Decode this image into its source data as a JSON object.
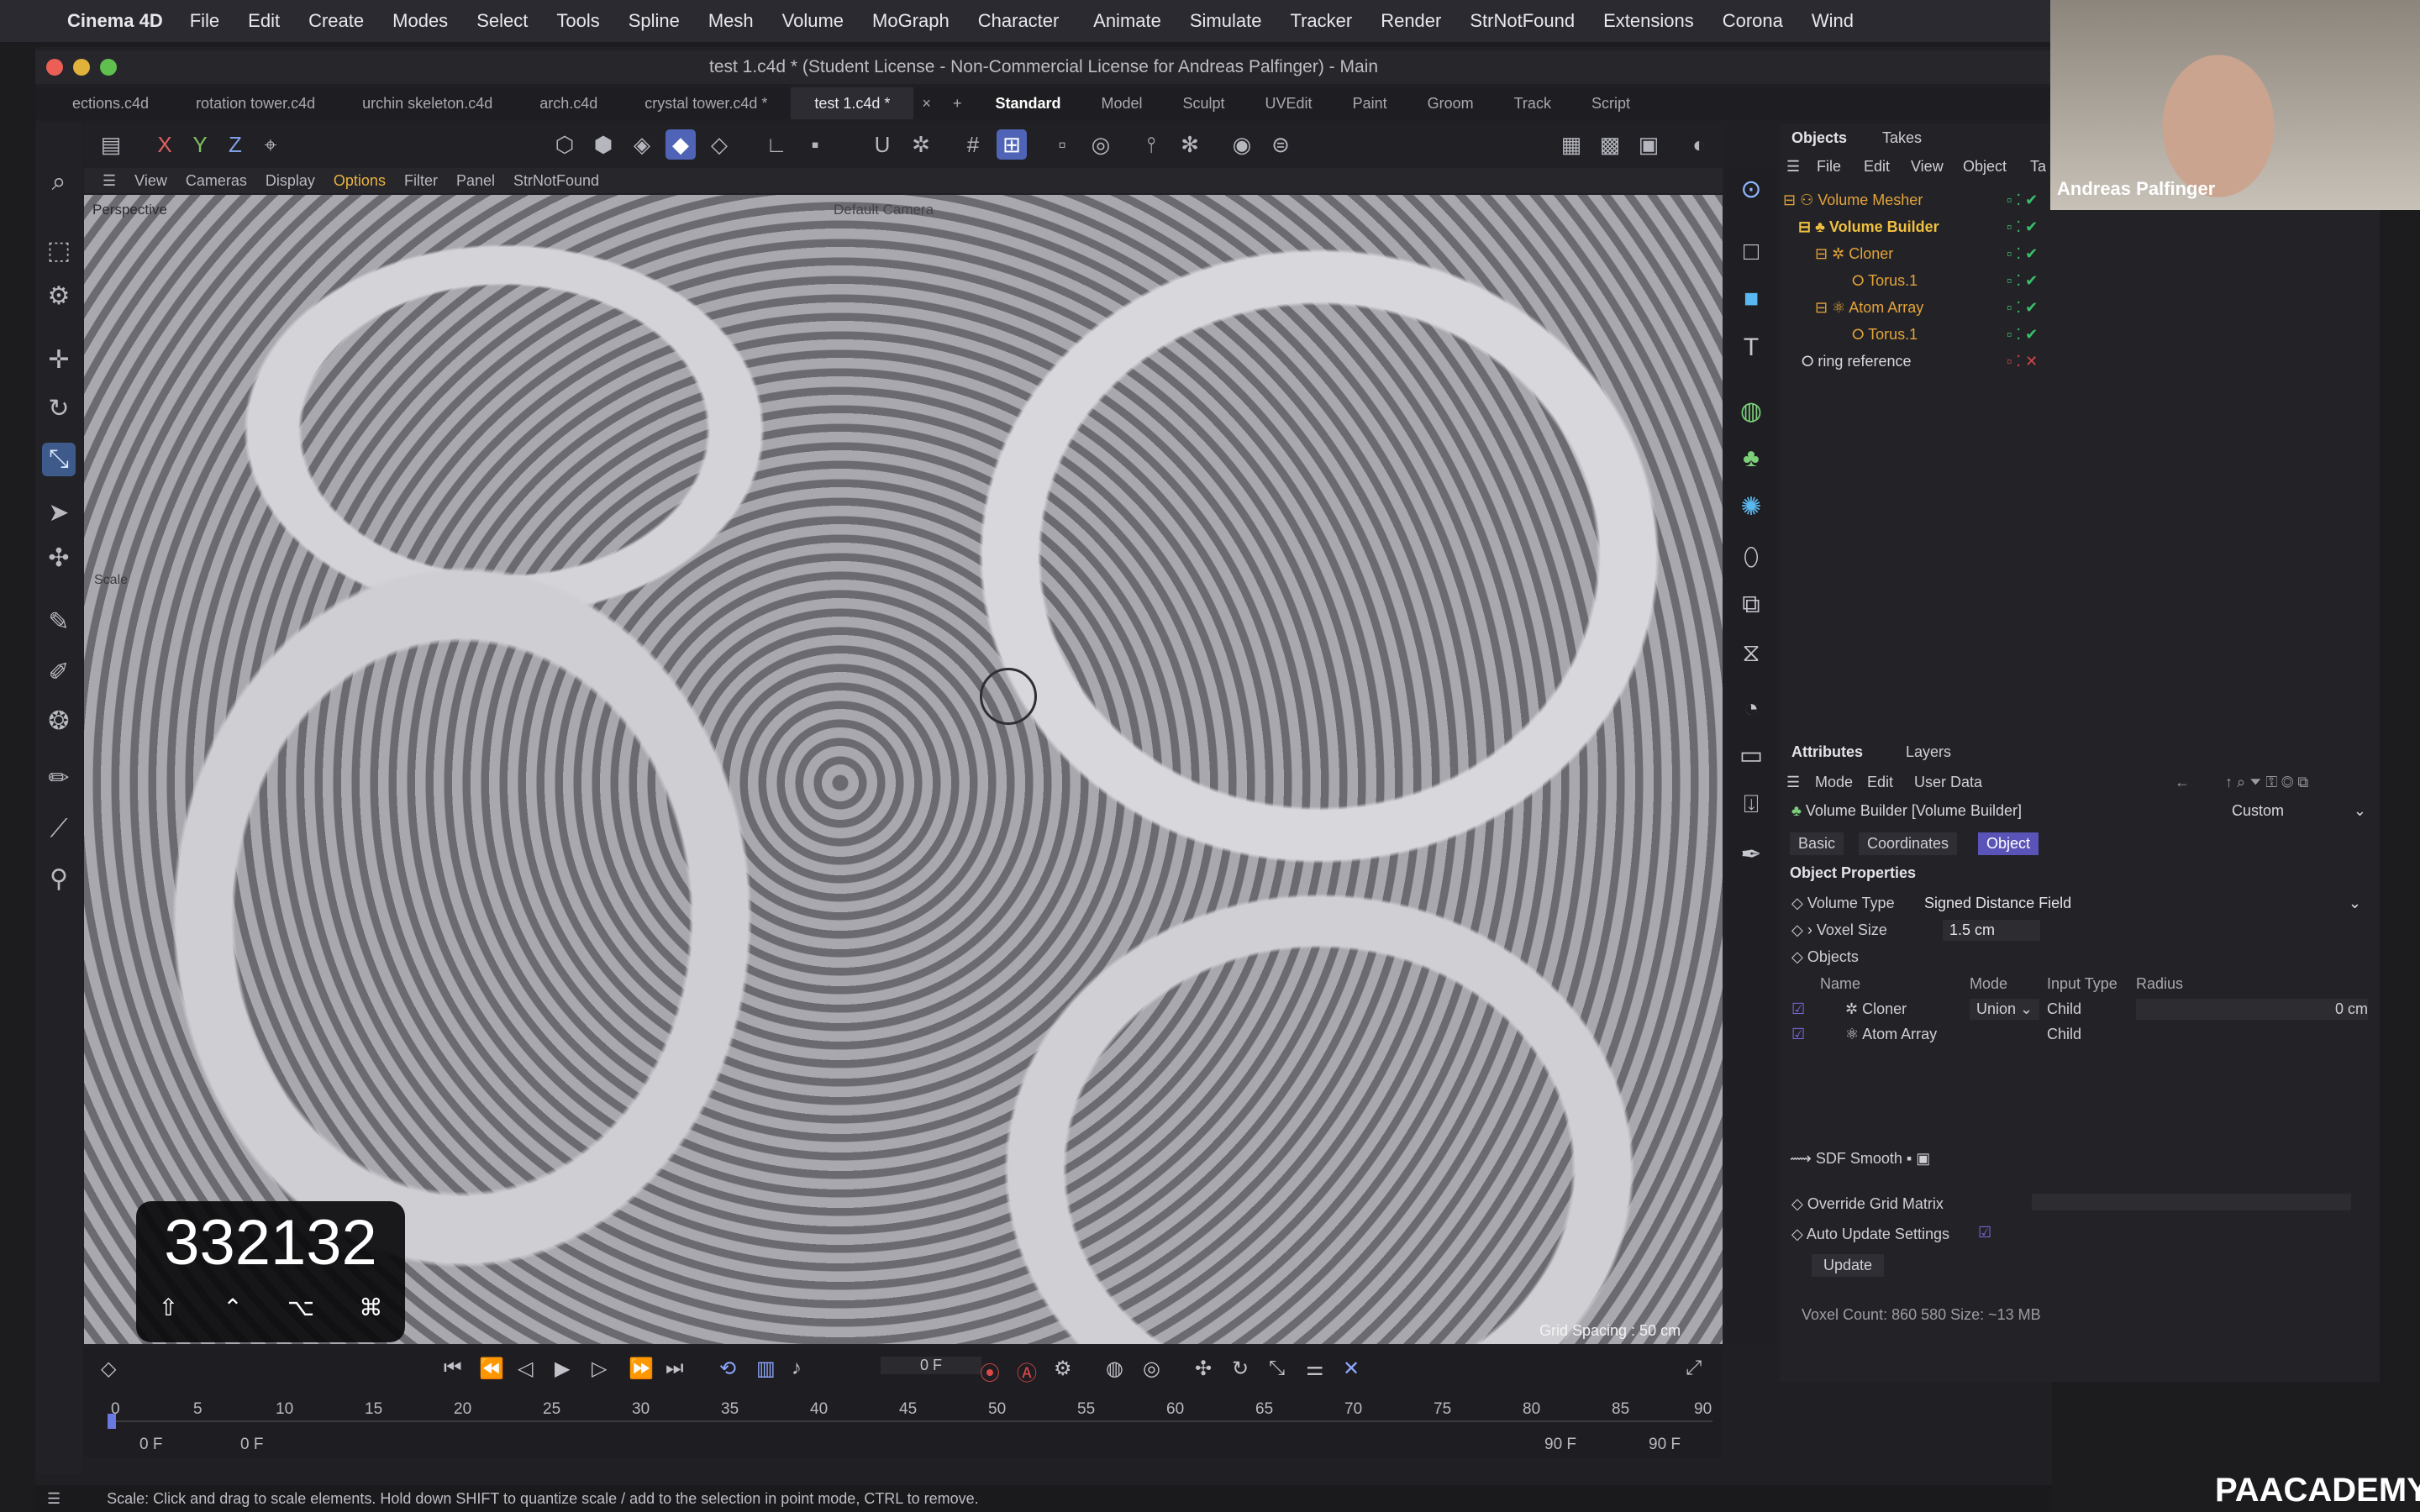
{
  "menubar": {
    "app": "Cinema 4D",
    "items": [
      "File",
      "Edit",
      "Create",
      "Modes",
      "Select",
      "Tools",
      "Spline",
      "Mesh",
      "Volume",
      "MoGraph",
      "Character"
    ],
    "right_items": [
      "Animate",
      "Simulate",
      "Tracker",
      "Render",
      "StrNotFound",
      "Extensions",
      "Corona",
      "Wind"
    ]
  },
  "window": {
    "title": "test 1.c4d * (Student License - Non-Commercial License for Andreas Palfinger) - Main"
  },
  "tabs": {
    "files": [
      "ections.c4d",
      "rotation tower.c4d",
      "urchin skeleton.c4d",
      "arch.c4d",
      "crystal tower.c4d *",
      "test 1.c4d *"
    ],
    "close": "×",
    "add": "+",
    "layouts": [
      "Standard",
      "Model",
      "Sculpt",
      "UVEdit",
      "Paint",
      "Groom",
      "Track",
      "Script"
    ]
  },
  "viewport": {
    "menu": [
      "View",
      "Cameras",
      "Display",
      "Options",
      "Filter",
      "Panel",
      "StrNotFound"
    ],
    "label": "Perspective",
    "camera": "Default Camera",
    "grid_spacing": "Grid Spacing : 50 cm",
    "scale_label": "Scale",
    "key_overlay": "332132",
    "key_symbols": [
      "⇧",
      "⌃",
      "⌥",
      "⌘"
    ]
  },
  "objects": {
    "tabs": [
      "Objects",
      "Takes"
    ],
    "menu": [
      "File",
      "Edit",
      "View",
      "Object",
      "Ta"
    ],
    "tree": [
      {
        "name": "Volume Mesher",
        "indent": 0
      },
      {
        "name": "Volume Builder",
        "indent": 1
      },
      {
        "name": "Cloner",
        "indent": 2
      },
      {
        "name": "Torus.1",
        "indent": 3
      },
      {
        "name": "Atom Array",
        "indent": 2
      },
      {
        "name": "Torus.1",
        "indent": 3
      },
      {
        "name": "ring reference",
        "indent": 0
      }
    ]
  },
  "attributes": {
    "tabs": [
      "Attributes",
      "Layers"
    ],
    "menu": [
      "Mode",
      "Edit",
      "User Data"
    ],
    "object_title": "Volume Builder [Volume Builder]",
    "preset": "Custom",
    "sub_tabs": [
      "Basic",
      "Coordinates",
      "Object"
    ],
    "section": "Object Properties",
    "volume_type_label": "Volume Type",
    "volume_type_value": "Signed Distance Field",
    "voxel_size_label": "Voxel Size",
    "voxel_size_value": "1.5 cm",
    "objects_label": "Objects",
    "table_headers": [
      "Name",
      "Mode",
      "Input Type",
      "Radius"
    ],
    "table_rows": [
      {
        "name": "Cloner",
        "mode": "Union",
        "input": "Child",
        "radius": "0 cm"
      },
      {
        "name": "Atom Array",
        "mode": "",
        "input": "Child",
        "radius": ""
      }
    ],
    "sdf_smooth": "SDF Smooth",
    "override_grid": "Override Grid Matrix",
    "auto_update": "Auto Update Settings",
    "update_button": "Update",
    "voxel_count": "Voxel Count: 860 580   Size: ~13 MB"
  },
  "timeline": {
    "current_frame": "0 F",
    "ticks": [
      "0",
      "5",
      "10",
      "15",
      "20",
      "25",
      "30",
      "35",
      "40",
      "45",
      "50",
      "55",
      "60",
      "65",
      "70",
      "75",
      "80",
      "85",
      "90"
    ],
    "start_a": "0 F",
    "start_b": "0 F",
    "end_a": "90 F",
    "end_b": "90 F"
  },
  "status": "Scale: Click and drag to scale elements. Hold down SHIFT to quantize scale / add to the selection in point mode, CTRL to remove.",
  "webcam": {
    "name": "Andreas Palfinger"
  },
  "logo": "PAACADEMY"
}
